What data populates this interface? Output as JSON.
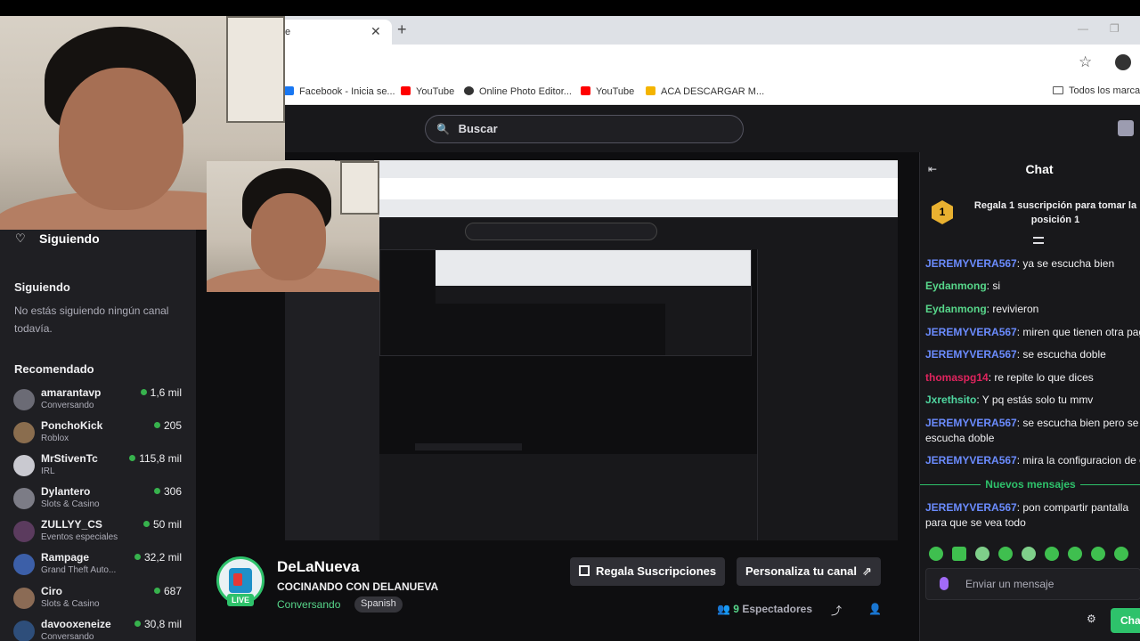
{
  "browser": {
    "tab_label": "e",
    "close_glyph": "✕",
    "new_tab_glyph": "+",
    "bookmarks": [
      {
        "label": "Facebook - Inicia se...",
        "color": "#1877f2"
      },
      {
        "label": "YouTube",
        "color": "#ff0000"
      },
      {
        "label": "Online Photo Editor...",
        "color": "#333333"
      },
      {
        "label": "YouTube",
        "color": "#ff0000"
      },
      {
        "label": "ACA DESCARGAR M...",
        "color": "#f4b400"
      }
    ],
    "bookmarks_folder": "Todos los marcad"
  },
  "topnav": {
    "search_placeholder": "Buscar"
  },
  "sidebar": {
    "following_header": "Siguiendo",
    "following_section": "Siguiendo",
    "following_empty": "No estás siguiendo ningún canal todavía.",
    "recommended_section": "Recomendado",
    "channels": [
      {
        "name": "amarantavp",
        "category": "Conversando",
        "viewers": "1,6 mil"
      },
      {
        "name": "PonchoKick",
        "category": "Roblox",
        "viewers": "205"
      },
      {
        "name": "MrStivenTc",
        "category": "IRL",
        "viewers": "115,8 mil"
      },
      {
        "name": "Dylantero",
        "category": "Slots & Casino",
        "viewers": "306"
      },
      {
        "name": "ZULLYY_CS",
        "category": "Eventos especiales",
        "viewers": "50 mil"
      },
      {
        "name": "Rampage",
        "category": "Grand Theft Auto...",
        "viewers": "32,2 mil"
      },
      {
        "name": "Ciro",
        "category": "Slots & Casino",
        "viewers": "687"
      },
      {
        "name": "davooxeneize",
        "category": "Conversando",
        "viewers": "30,8 mil"
      }
    ]
  },
  "stream": {
    "streamer": "DeLaNueva",
    "title": "COCINANDO CON DELANUEVA",
    "category": "Conversando",
    "language": "Spanish",
    "live_badge": "LIVE",
    "gift_button": "Regala Suscripciones",
    "customize_button": "Personaliza tu canal",
    "viewers_count": "9",
    "viewers_label": "Espectadores"
  },
  "chat": {
    "title": "Chat",
    "promo_rank": "1",
    "promo_text": "Regala 1 suscripción para tomar la posición 1",
    "new_messages": "Nuevos mensajes",
    "input_placeholder": "Enviar un mensaje",
    "send_button": "Chat",
    "messages": [
      {
        "user": "JEREMYVERA567",
        "text": ": ya se escucha bien",
        "color": "#6b8cff"
      },
      {
        "user": "Eydanmong",
        "text": ": si",
        "color": "#57d68a"
      },
      {
        "user": "Eydanmong",
        "text": ": revivieron",
        "color": "#57d68a"
      },
      {
        "user": "JEREMYVERA567",
        "text": ": miren que tienen otra pagin",
        "color": "#6b8cff"
      },
      {
        "user": "JEREMYVERA567",
        "text": ": se escucha doble",
        "color": "#6b8cff"
      },
      {
        "user": "thomaspg14",
        "text": ": re repite lo que dices",
        "color": "#e0245e"
      },
      {
        "user": "Jxrethsito",
        "text": ": Y pq estás solo tu mmv",
        "color": "#4fd6a0"
      },
      {
        "user": "JEREMYVERA567",
        "text": ": se escucha bien pero se escucha doble",
        "color": "#6b8cff"
      },
      {
        "user": "JEREMYVERA567",
        "text": ": mira la configuracion de ob",
        "color": "#6b8cff"
      },
      {
        "user": "JEREMYVERA567",
        "text": ": pon compartir pantalla para que se vea todo",
        "color": "#6b8cff"
      }
    ]
  },
  "colors": {
    "accent_green": "#2ec26b",
    "background": "#0e0e10"
  }
}
